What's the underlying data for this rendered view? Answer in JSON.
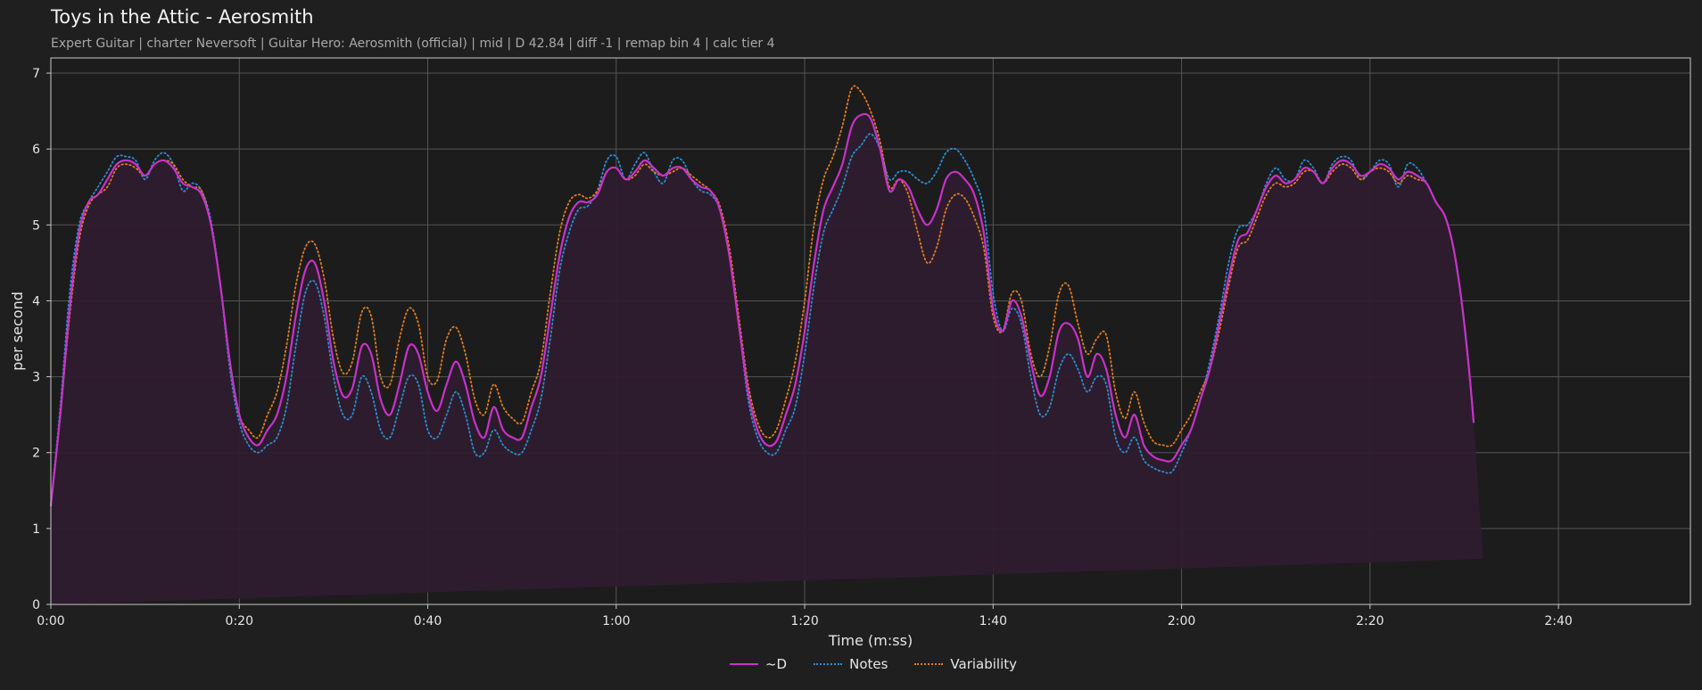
{
  "header": {
    "title": "Toys in the Attic - Aerosmith",
    "subtitle": "Expert Guitar  |  charter Neversoft  |  Guitar Hero: Aerosmith (official)  |  mid  |  D 42.84  |  diff -1  |  remap bin 4  |  calc tier 4"
  },
  "colors": {
    "background": "#1f1f1f",
    "plot_bg": "#1c1c1c",
    "fill": "#2e1c2e",
    "d": "#c832c8",
    "notes": "#2a8ecf",
    "variability": "#e07b22",
    "grid": "#555555",
    "axes": "#c8c8c8"
  },
  "chart_data": {
    "type": "line",
    "xlabel": "Time (m:ss)",
    "ylabel": "per second",
    "xlim": [
      0,
      174
    ],
    "ylim": [
      0,
      7.2
    ],
    "x_ticks": [
      0,
      20,
      40,
      60,
      80,
      100,
      120,
      140,
      160
    ],
    "x_tick_labels": [
      "0:00",
      "0:20",
      "0:40",
      "1:00",
      "1:20",
      "1:40",
      "2:00",
      "2:20",
      "2:40"
    ],
    "y_ticks": [
      0,
      1,
      2,
      3,
      4,
      5,
      6,
      7
    ],
    "y_tick_labels": [
      "0",
      "1",
      "2",
      "3",
      "4",
      "5",
      "6",
      "7"
    ],
    "grid": true,
    "legend_position": "bottom-center",
    "x": [
      0,
      1,
      2,
      3,
      4,
      5,
      6,
      7,
      8,
      9,
      10,
      11,
      12,
      13,
      14,
      15,
      16,
      17,
      18,
      19,
      20,
      21,
      22,
      23,
      24,
      25,
      26,
      27,
      28,
      29,
      30,
      31,
      32,
      33,
      34,
      35,
      36,
      37,
      38,
      39,
      40,
      41,
      42,
      43,
      44,
      45,
      46,
      47,
      48,
      49,
      50,
      51,
      52,
      53,
      54,
      55,
      56,
      57,
      58,
      59,
      60,
      61,
      62,
      63,
      64,
      65,
      66,
      67,
      68,
      69,
      70,
      71,
      72,
      73,
      74,
      75,
      76,
      77,
      78,
      79,
      80,
      81,
      82,
      83,
      84,
      85,
      86,
      87,
      88,
      89,
      90,
      91,
      92,
      93,
      94,
      95,
      96,
      97,
      98,
      99,
      100,
      101,
      102,
      103,
      104,
      105,
      106,
      107,
      108,
      109,
      110,
      111,
      112,
      113,
      114,
      115,
      116,
      117,
      118,
      119,
      120,
      121,
      122,
      123,
      124,
      125,
      126,
      127,
      128,
      129,
      130,
      131,
      132,
      133,
      134,
      135,
      136,
      137,
      138,
      139,
      140,
      141,
      142,
      143,
      144,
      145,
      146,
      147,
      148,
      149,
      150,
      151,
      152,
      153,
      154,
      155,
      156,
      157,
      158,
      159,
      160,
      161,
      162,
      163,
      164,
      165,
      166,
      167,
      168,
      169,
      170,
      171,
      172,
      173,
      174
    ],
    "series": [
      {
        "name": "~D",
        "style": "solid",
        "fill": true,
        "values": [
          1.3,
          2.5,
          3.9,
          4.9,
          5.3,
          5.4,
          5.6,
          5.8,
          5.85,
          5.8,
          5.65,
          5.8,
          5.85,
          5.75,
          5.55,
          5.5,
          5.4,
          5.0,
          4.2,
          3.2,
          2.5,
          2.2,
          2.1,
          2.3,
          2.5,
          3.0,
          3.8,
          4.4,
          4.5,
          4.0,
          3.2,
          2.75,
          2.85,
          3.4,
          3.3,
          2.7,
          2.5,
          2.9,
          3.4,
          3.3,
          2.8,
          2.55,
          2.9,
          3.2,
          2.9,
          2.4,
          2.2,
          2.6,
          2.3,
          2.2,
          2.2,
          2.6,
          3.0,
          3.8,
          4.6,
          5.1,
          5.3,
          5.3,
          5.4,
          5.7,
          5.75,
          5.6,
          5.7,
          5.85,
          5.75,
          5.65,
          5.75,
          5.75,
          5.6,
          5.5,
          5.45,
          5.2,
          4.6,
          3.7,
          2.8,
          2.3,
          2.1,
          2.15,
          2.5,
          2.9,
          3.6,
          4.5,
          5.2,
          5.5,
          5.8,
          6.3,
          6.45,
          6.4,
          6.0,
          5.45,
          5.6,
          5.5,
          5.2,
          5.0,
          5.2,
          5.6,
          5.7,
          5.6,
          5.4,
          4.9,
          3.9,
          3.6,
          4.0,
          3.8,
          3.2,
          2.75,
          3.0,
          3.6,
          3.7,
          3.5,
          3.0,
          3.3,
          3.1,
          2.5,
          2.2,
          2.5,
          2.1,
          1.95,
          1.9,
          1.9,
          2.1,
          2.3,
          2.7,
          3.1,
          3.7,
          4.3,
          4.8,
          4.9,
          5.2,
          5.5,
          5.65,
          5.55,
          5.6,
          5.75,
          5.7,
          5.55,
          5.75,
          5.85,
          5.8,
          5.65,
          5.7,
          5.8,
          5.75,
          5.6,
          5.7,
          5.65,
          5.55,
          5.3,
          5.1,
          4.6,
          3.7,
          2.4,
          0.6
        ]
      },
      {
        "name": "Notes",
        "style": "dotted",
        "values": [
          1.3,
          2.6,
          4.1,
          5.0,
          5.3,
          5.5,
          5.7,
          5.9,
          5.9,
          5.85,
          5.6,
          5.85,
          5.95,
          5.8,
          5.45,
          5.55,
          5.45,
          5.05,
          4.2,
          3.1,
          2.4,
          2.1,
          2.0,
          2.1,
          2.2,
          2.6,
          3.4,
          4.1,
          4.25,
          3.8,
          3.0,
          2.5,
          2.5,
          3.0,
          2.8,
          2.3,
          2.2,
          2.6,
          3.0,
          2.9,
          2.3,
          2.2,
          2.5,
          2.8,
          2.5,
          2.0,
          2.0,
          2.3,
          2.1,
          2.0,
          2.0,
          2.3,
          2.7,
          3.5,
          4.4,
          4.9,
          5.2,
          5.25,
          5.45,
          5.85,
          5.9,
          5.6,
          5.8,
          5.95,
          5.7,
          5.55,
          5.85,
          5.85,
          5.6,
          5.45,
          5.4,
          5.2,
          4.6,
          3.7,
          2.7,
          2.2,
          2.0,
          2.0,
          2.3,
          2.6,
          3.3,
          4.2,
          4.9,
          5.2,
          5.5,
          5.9,
          6.05,
          6.2,
          6.0,
          5.6,
          5.7,
          5.7,
          5.6,
          5.55,
          5.7,
          5.95,
          6.0,
          5.85,
          5.6,
          5.2,
          4.1,
          3.6,
          3.9,
          3.7,
          3.0,
          2.5,
          2.6,
          3.1,
          3.3,
          3.1,
          2.8,
          3.0,
          2.9,
          2.2,
          2.0,
          2.2,
          1.9,
          1.8,
          1.75,
          1.75,
          2.0,
          2.3,
          2.7,
          3.2,
          3.8,
          4.5,
          4.95,
          5.0,
          5.2,
          5.55,
          5.75,
          5.6,
          5.6,
          5.85,
          5.75,
          5.55,
          5.8,
          5.9,
          5.85,
          5.6,
          5.7,
          5.85,
          5.8,
          5.5,
          5.8,
          5.75,
          5.55,
          5.3,
          5.1,
          4.6,
          3.7,
          2.4,
          0.6
        ]
      },
      {
        "name": "Variability",
        "style": "dotted",
        "values": [
          1.3,
          2.5,
          3.8,
          4.8,
          5.25,
          5.4,
          5.5,
          5.75,
          5.8,
          5.75,
          5.65,
          5.8,
          5.85,
          5.8,
          5.6,
          5.5,
          5.45,
          5.0,
          4.2,
          3.2,
          2.5,
          2.3,
          2.2,
          2.5,
          2.8,
          3.4,
          4.2,
          4.7,
          4.75,
          4.3,
          3.5,
          3.05,
          3.2,
          3.85,
          3.8,
          3.0,
          2.9,
          3.5,
          3.9,
          3.7,
          3.0,
          2.95,
          3.5,
          3.65,
          3.3,
          2.7,
          2.5,
          2.9,
          2.6,
          2.45,
          2.4,
          2.8,
          3.2,
          4.1,
          4.9,
          5.3,
          5.4,
          5.35,
          5.45,
          5.7,
          5.75,
          5.6,
          5.65,
          5.8,
          5.7,
          5.65,
          5.7,
          5.75,
          5.65,
          5.55,
          5.45,
          5.25,
          4.7,
          3.8,
          2.9,
          2.4,
          2.2,
          2.3,
          2.7,
          3.2,
          4.0,
          5.0,
          5.6,
          5.9,
          6.3,
          6.8,
          6.75,
          6.5,
          6.1,
          5.5,
          5.6,
          5.4,
          4.9,
          4.5,
          4.7,
          5.2,
          5.4,
          5.35,
          5.1,
          4.7,
          3.8,
          3.6,
          4.1,
          4.0,
          3.3,
          3.0,
          3.4,
          4.1,
          4.2,
          3.7,
          3.3,
          3.5,
          3.55,
          2.8,
          2.45,
          2.8,
          2.4,
          2.15,
          2.1,
          2.1,
          2.3,
          2.5,
          2.8,
          3.1,
          3.6,
          4.2,
          4.7,
          4.8,
          5.1,
          5.4,
          5.55,
          5.5,
          5.55,
          5.7,
          5.7,
          5.55,
          5.7,
          5.8,
          5.75,
          5.6,
          5.7,
          5.75,
          5.7,
          5.55,
          5.65,
          5.6,
          5.55,
          5.3,
          5.1,
          4.6,
          3.7,
          2.4,
          0.6
        ]
      }
    ]
  }
}
